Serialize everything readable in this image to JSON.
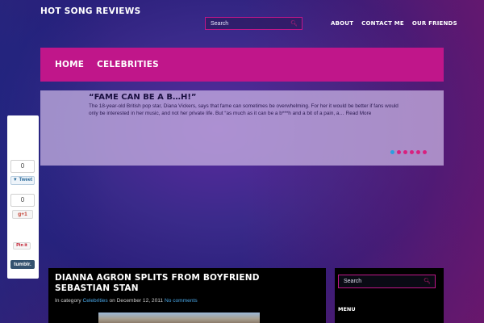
{
  "site": {
    "title": "HOT SONG REVIEWS"
  },
  "top_search": {
    "placeholder": "Search",
    "icon": "search-icon"
  },
  "top_nav": [
    {
      "label": "ABOUT"
    },
    {
      "label": "CONTACT ME"
    },
    {
      "label": "OUR FRIENDS"
    }
  ],
  "main_nav": [
    {
      "label": "HOME"
    },
    {
      "label": "CELEBRITIES"
    }
  ],
  "slider": {
    "title": "“FAME CAN BE A B…H!”",
    "text": "The 18-year-old British pop star, Diana Vickers, says that fame can sometimes be overwhelming. For her it would be better if fans would only be interested in her music, and not her private life. But “as much as it can be a b***h and a bit of a pain, a… Read More",
    "dots": 6,
    "active_dot": 0
  },
  "share": {
    "twitter_count": "0",
    "twitter_label": "Tweet",
    "gplus_count": "0",
    "gplus_label": "g+1",
    "pinterest_label": "Pin it",
    "tumblr_label": "tumblr."
  },
  "post": {
    "title": "DIANNA AGRON SPLITS FROM BOYFRIEND SEBASTIAN STAN",
    "meta_prefix": "In category",
    "category": "Celebrities",
    "meta_on": "on",
    "date": "December 12, 2011",
    "comments": "No comments"
  },
  "sidebar": {
    "search_placeholder": "Search",
    "menu_title": "MENU"
  },
  "colors": {
    "accent": "#c0168a",
    "link": "#4aa8e8",
    "active_dot": "#2a9fe0"
  }
}
